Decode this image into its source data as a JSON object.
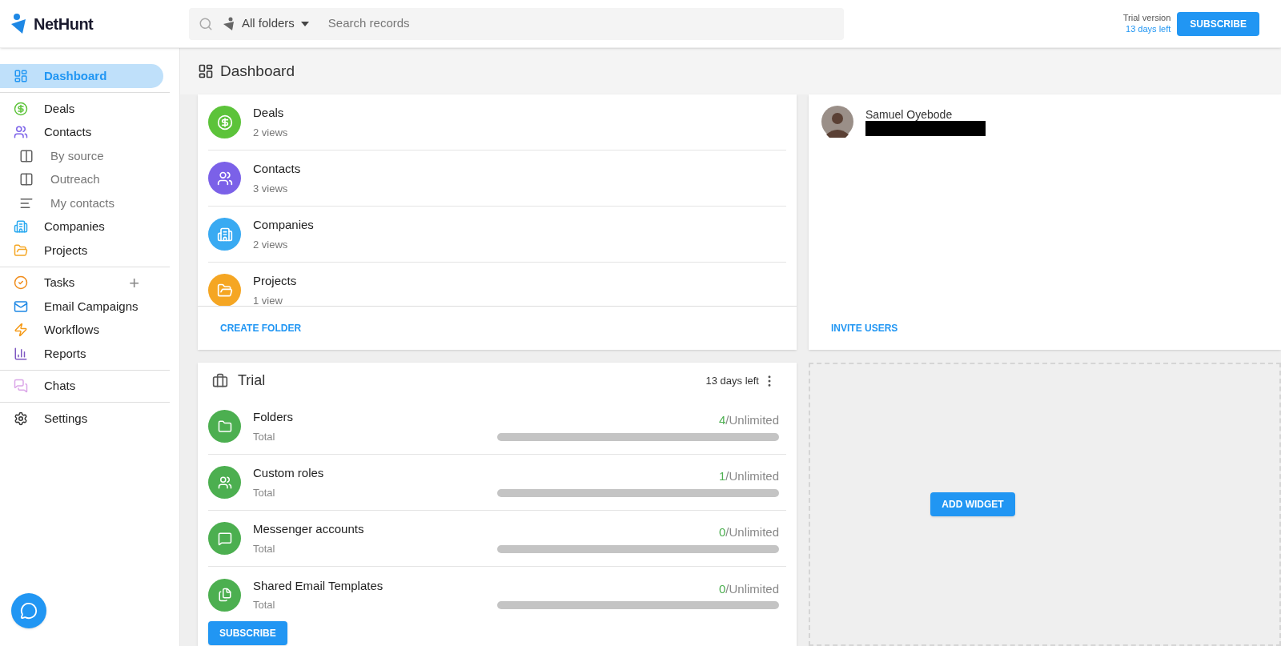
{
  "brand": {
    "name": "NetHunt"
  },
  "search": {
    "folder": "All folders",
    "placeholder": "Search records"
  },
  "trial_status": {
    "label": "Trial version",
    "days": "13 days left"
  },
  "subscribe_button": "SUBSCRIBE",
  "sidebar": {
    "groups": [
      [
        {
          "label": "Dashboard",
          "kind": "main",
          "selected": true,
          "color": "#2196f3"
        }
      ],
      [
        {
          "label": "Deals",
          "kind": "main",
          "selected": false,
          "color": "#5cc33a"
        },
        {
          "label": "Contacts",
          "kind": "main",
          "selected": false,
          "color": "#7b61e8"
        },
        {
          "label": "By source",
          "kind": "sub",
          "selected": false,
          "color": "#616161"
        },
        {
          "label": "Outreach",
          "kind": "sub",
          "selected": false,
          "color": "#616161"
        },
        {
          "label": "My contacts",
          "kind": "sub",
          "selected": false,
          "color": "#616161"
        },
        {
          "label": "Companies",
          "kind": "main",
          "selected": false,
          "color": "#29a9f0"
        },
        {
          "label": "Projects",
          "kind": "main",
          "selected": false,
          "color": "#f5a623"
        }
      ],
      [
        {
          "label": "Tasks",
          "kind": "main",
          "selected": false,
          "color": "#f08c1a",
          "add": "+"
        },
        {
          "label": "Email Campaigns",
          "kind": "main",
          "selected": false,
          "color": "#1e88e5"
        },
        {
          "label": "Workflows",
          "kind": "main",
          "selected": false,
          "color": "#f59b1a"
        },
        {
          "label": "Reports",
          "kind": "main",
          "selected": false,
          "color": "#7e57c2"
        }
      ],
      [
        {
          "label": "Chats",
          "kind": "main",
          "selected": false,
          "color": "#dba6e8"
        }
      ],
      [
        {
          "label": "Settings",
          "kind": "main",
          "selected": false,
          "color": "#333333"
        }
      ]
    ]
  },
  "page_header": {
    "title": "Dashboard"
  },
  "folders_widget": {
    "folders": [
      {
        "name": "Deals",
        "views": "2 views",
        "color": "#5cc33a"
      },
      {
        "name": "Contacts",
        "views": "3 views",
        "color": "#7b61e8"
      },
      {
        "name": "Companies",
        "views": "2 views",
        "color": "#39aaf2"
      },
      {
        "name": "Projects",
        "views": "1 view",
        "color": "#f5a623"
      }
    ],
    "action": "CREATE FOLDER"
  },
  "users_widget": {
    "users": [
      {
        "name": "Samuel Oyebode",
        "redacted": true
      }
    ],
    "action": "INVITE USERS"
  },
  "trial_widget": {
    "title": "Trial",
    "days_left": "13 days left",
    "items": [
      {
        "name": "Folders",
        "sub": "Total",
        "used": "4",
        "limit": "/Unlimited"
      },
      {
        "name": "Custom roles",
        "sub": "Total",
        "used": "1",
        "limit": "/Unlimited"
      },
      {
        "name": "Messenger accounts",
        "sub": "Total",
        "used": "0",
        "limit": "/Unlimited"
      },
      {
        "name": "Shared Email Templates",
        "sub": "Total",
        "used": "0",
        "limit": "/Unlimited"
      }
    ],
    "action": "SUBSCRIBE"
  },
  "add_widget": {
    "label": "ADD WIDGET"
  }
}
